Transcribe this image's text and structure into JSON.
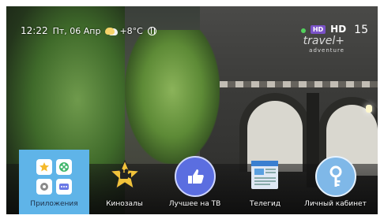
{
  "status_bar": {
    "time": "12:22",
    "date": "Пт, 06 Апр",
    "temperature": "+8°C"
  },
  "channel": {
    "hd_badge": "HD",
    "hd_label": "HD",
    "number": "15",
    "logo_line1": "travel+",
    "logo_line2": "adventure"
  },
  "menu": {
    "items": [
      {
        "label": "Приложения",
        "icon": "apps-grid-icon",
        "active": true
      },
      {
        "label": "Кинозалы",
        "icon": "cinema-star-icon"
      },
      {
        "label": "Лучшее на ТВ",
        "icon": "thumbs-up-icon"
      },
      {
        "label": "Телегид",
        "icon": "tv-guide-icon"
      },
      {
        "label": "Личный кабинет",
        "icon": "key-icon"
      }
    ]
  },
  "colors": {
    "accent": "#5fb4e8",
    "badge": "#7a52c8",
    "thumbs_circle": "#5b6ee0",
    "key_circle": "#7fb8e8"
  }
}
